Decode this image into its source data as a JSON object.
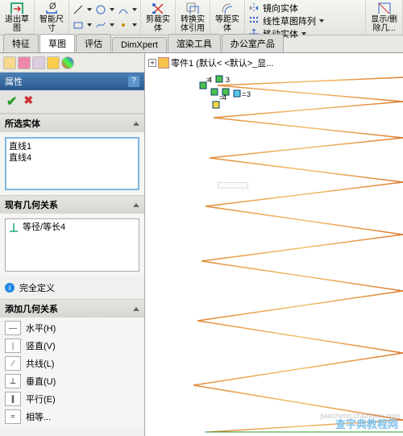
{
  "ribbon": {
    "exit_sketch": "退出草\n图",
    "smart_dim": "智能尺\n寸",
    "trim": "剪裁实\n体",
    "convert": "转换实\n体引用",
    "offset": "等距实\n体",
    "mirror": "镜向实体",
    "pattern": "线性草图阵列",
    "move": "移动实体",
    "disp_del": "显示/删\n除几..."
  },
  "tabs": [
    "特征",
    "草图",
    "评估",
    "DimXpert",
    "渲染工具",
    "办公室产品"
  ],
  "active_tab_index": 1,
  "tree_label": "零件1  (默认< <默认>_显...",
  "panel": {
    "title": "属性",
    "sec_selected": "所选实体",
    "selected_items": [
      "直线1",
      "直线4"
    ],
    "sec_existing": "现有几何关系",
    "existing_items": [
      "等径/等长4"
    ],
    "status": "完全定义",
    "sec_add": "添加几何关系",
    "relations": [
      {
        "icon": "—",
        "label": "水平(H)"
      },
      {
        "icon": "|",
        "label": "竖直(V)"
      },
      {
        "icon": "⁄",
        "label": "共线(L)"
      },
      {
        "icon": "⊥",
        "label": "垂直(U)"
      },
      {
        "icon": "∥",
        "label": "平行(E)"
      },
      {
        "icon": "=",
        "label": "相等..."
      }
    ]
  },
  "canvas": {
    "node_labels": [
      "4",
      "3",
      "4",
      "3"
    ],
    "placeholder": " "
  },
  "watermark": "查字典教程网",
  "watermark2": "jiaocheng.chazidian.com"
}
